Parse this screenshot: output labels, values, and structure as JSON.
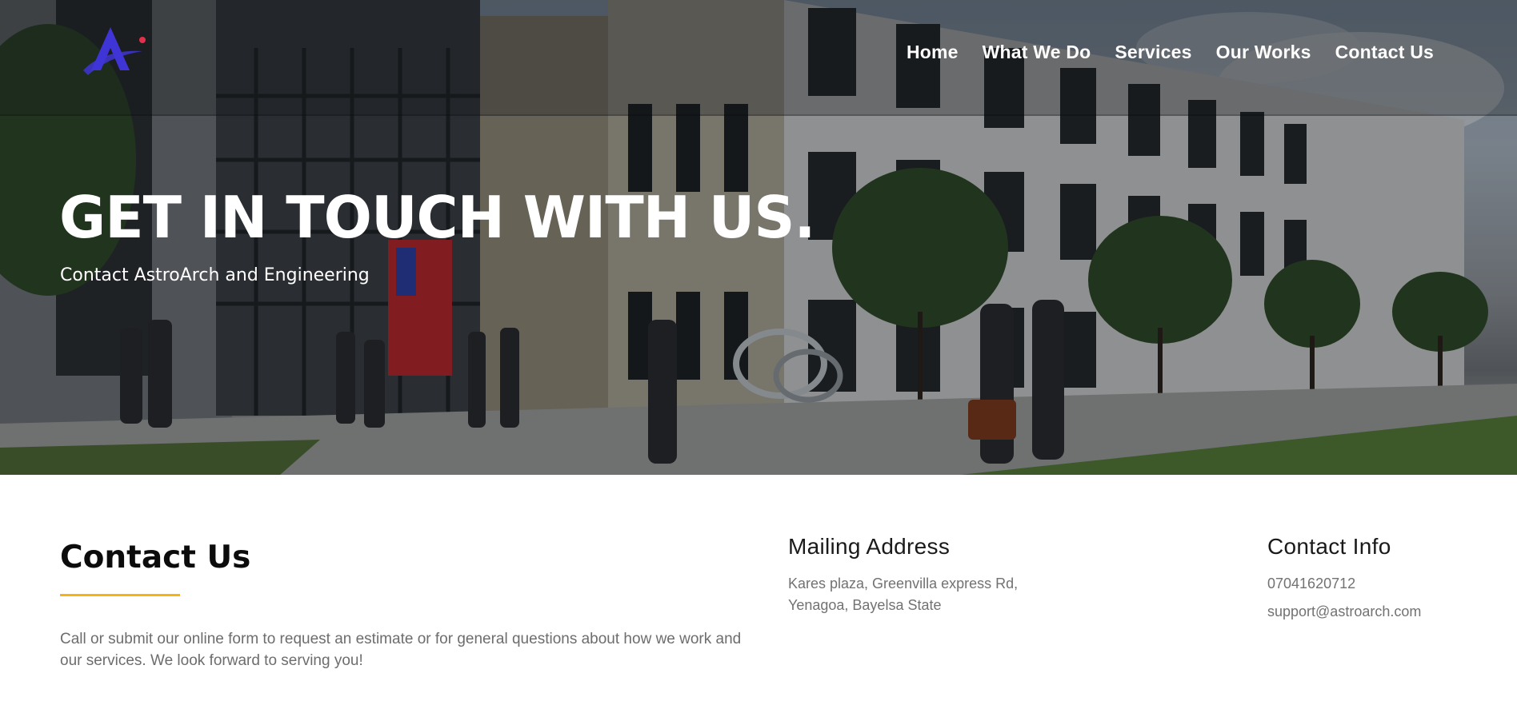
{
  "header": {
    "nav": [
      {
        "label": "Home"
      },
      {
        "label": "What We Do"
      },
      {
        "label": "Services"
      },
      {
        "label": "Our Works"
      },
      {
        "label": "Contact Us"
      }
    ]
  },
  "hero": {
    "title": "GET IN TOUCH WITH US.",
    "subtitle": "Contact AstroArch and Engineering"
  },
  "contact": {
    "title": "Contact Us",
    "description": "Call or submit our online form to request an estimate or for general questions about how we work and our services. We look forward to serving you!"
  },
  "mailing": {
    "heading": "Mailing Address",
    "line1": "Kares plaza, Greenvilla express Rd,",
    "line2": "Yenagoa, Bayelsa State"
  },
  "contact_info": {
    "heading": "Contact Info",
    "phone": "07041620712",
    "email": "support@astroarch.com"
  },
  "colors": {
    "accent": "#f5b316",
    "logo_blue": "#3f35d6",
    "logo_red": "#e0304a"
  }
}
